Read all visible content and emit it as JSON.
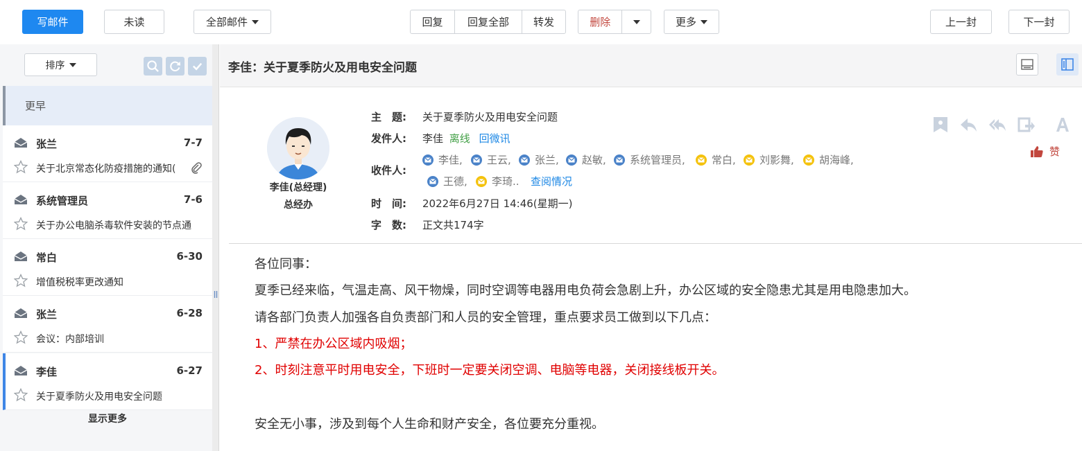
{
  "toolbar": {
    "compose": "写邮件",
    "unread": "未读",
    "all_mail": "全部邮件",
    "reply": "回复",
    "reply_all": "回复全部",
    "forward": "转发",
    "delete": "删除",
    "more": "更多",
    "prev": "上一封",
    "next": "下一封",
    "delete_color": "#c2473e",
    "accent": "#1e88f0"
  },
  "sidebar": {
    "sort_label": "排序",
    "tools": [
      "search-icon",
      "refresh-icon",
      "check-icon"
    ],
    "section_label": "更早",
    "items": [
      {
        "from": "张兰",
        "date": "7-7",
        "subject": "关于北京常态化防疫措施的通知(",
        "attachment": true
      },
      {
        "from": "系统管理员",
        "date": "7-6",
        "subject": "关于办公电脑杀毒软件安装的节点通",
        "attachment": false
      },
      {
        "from": "常白",
        "date": "6-30",
        "subject": "增值税税率更改通知",
        "attachment": false
      },
      {
        "from": "张兰",
        "date": "6-28",
        "subject": "会议：内部培训",
        "attachment": false
      },
      {
        "from": "李佳",
        "date": "6-27",
        "subject": "关于夏季防火及用电安全问题",
        "attachment": false,
        "active": true
      }
    ],
    "show_more": "显示更多"
  },
  "mail": {
    "header_title": "李佳：关于夏季防火及用电安全问题",
    "sender_name": "李佳(总经理)",
    "sender_dept": "总经办",
    "labels": {
      "subject": "主　题:",
      "from": "发件人:",
      "to": "收件人:",
      "time": "时　间:",
      "words": "字　数:"
    },
    "subject": "关于夏季防火及用电安全问题",
    "from_name": "李佳",
    "from_status": "离线",
    "from_reply_link": "回微讯",
    "recipients_row1": [
      {
        "name": "李佳,",
        "type": "blue"
      },
      {
        "name": "王云,",
        "type": "blue"
      },
      {
        "name": "张兰,",
        "type": "blue"
      },
      {
        "name": "赵敏,",
        "type": "blue"
      },
      {
        "name": "系统管理员,",
        "type": "blue"
      },
      {
        "name": "常白,",
        "type": "yellow"
      },
      {
        "name": "刘影舞,",
        "type": "yellow"
      },
      {
        "name": "胡海峰,",
        "type": "yellow"
      }
    ],
    "recipients_row2": [
      {
        "name": "王德,",
        "type": "blue"
      },
      {
        "name": "李琦..",
        "type": "yellow"
      }
    ],
    "read_status_link": "查阅情况",
    "time": "2022年6月27日 14:46(星期一)",
    "word_count": "正文共174字",
    "like_label": "赞",
    "actions": [
      "bookmark-icon",
      "reply-icon",
      "reply-all-icon",
      "forward-icon",
      "font-icon"
    ],
    "body": {
      "greeting": "各位同事：",
      "p1": "夏季已经来临，气温走高、风干物燥，同时空调等电器用电负荷会急剧上升，办公区域的安全隐患尤其是用电隐患加大。",
      "p2": "请各部门负责人加强各自负责部门和人员的安全管理，重点要求员工做到以下几点：",
      "item1": "1、严禁在办公区域内吸烟；",
      "item2": "2、时刻注意平时用电安全，下班时一定要关闭空调、电脑等电器，关闭接线板开关。",
      "closing": "安全无小事，涉及到每个人生命和财产安全，各位要充分重视。"
    }
  }
}
